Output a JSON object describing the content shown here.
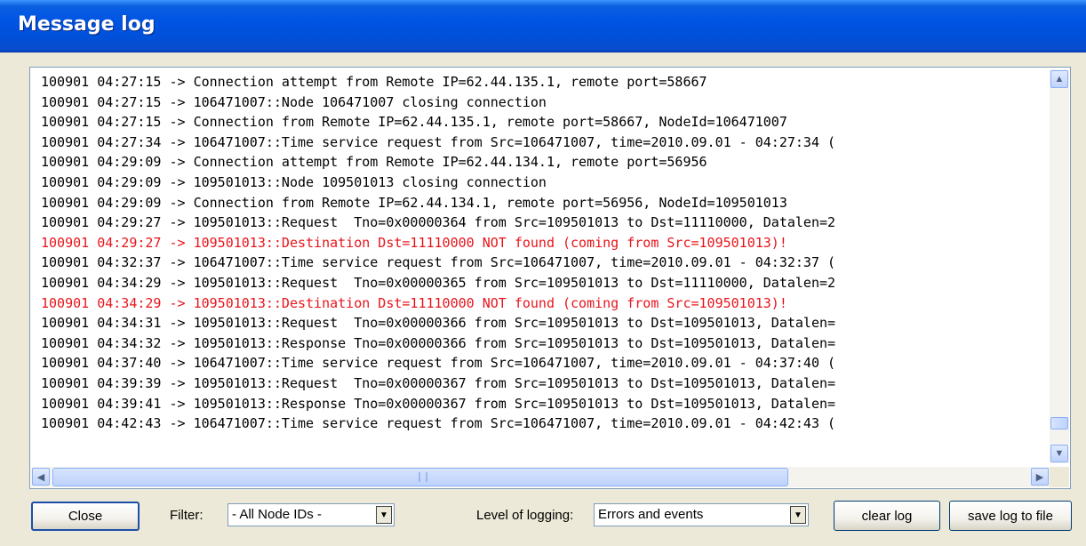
{
  "window": {
    "title": "Message log"
  },
  "log": {
    "lines": [
      {
        "text": "100901 04:27:15 -> Connection attempt from Remote IP=62.44.135.1, remote port=58667",
        "level": "info"
      },
      {
        "text": "100901 04:27:15 -> 106471007::Node 106471007 closing connection",
        "level": "info"
      },
      {
        "text": "100901 04:27:15 -> Connection from Remote IP=62.44.135.1, remote port=58667, NodeId=106471007",
        "level": "info"
      },
      {
        "text": "100901 04:27:34 -> 106471007::Time service request from Src=106471007, time=2010.09.01 - 04:27:34 (",
        "level": "info"
      },
      {
        "text": "100901 04:29:09 -> Connection attempt from Remote IP=62.44.134.1, remote port=56956",
        "level": "info"
      },
      {
        "text": "100901 04:29:09 -> 109501013::Node 109501013 closing connection",
        "level": "info"
      },
      {
        "text": "100901 04:29:09 -> Connection from Remote IP=62.44.134.1, remote port=56956, NodeId=109501013",
        "level": "info"
      },
      {
        "text": "100901 04:29:27 -> 109501013::Request  Tno=0x00000364 from Src=109501013 to Dst=11110000, Datalen=2",
        "level": "info"
      },
      {
        "text": "100901 04:29:27 -> 109501013::Destination Dst=11110000 NOT found (coming from Src=109501013)!",
        "level": "error"
      },
      {
        "text": "100901 04:32:37 -> 106471007::Time service request from Src=106471007, time=2010.09.01 - 04:32:37 (",
        "level": "info"
      },
      {
        "text": "100901 04:34:29 -> 109501013::Request  Tno=0x00000365 from Src=109501013 to Dst=11110000, Datalen=2",
        "level": "info"
      },
      {
        "text": "100901 04:34:29 -> 109501013::Destination Dst=11110000 NOT found (coming from Src=109501013)!",
        "level": "error"
      },
      {
        "text": "100901 04:34:31 -> 109501013::Request  Tno=0x00000366 from Src=109501013 to Dst=109501013, Datalen=",
        "level": "info"
      },
      {
        "text": "100901 04:34:32 -> 109501013::Response Tno=0x00000366 from Src=109501013 to Dst=109501013, Datalen=",
        "level": "info"
      },
      {
        "text": "100901 04:37:40 -> 106471007::Time service request from Src=106471007, time=2010.09.01 - 04:37:40 (",
        "level": "info"
      },
      {
        "text": "100901 04:39:39 -> 109501013::Request  Tno=0x00000367 from Src=109501013 to Dst=109501013, Datalen=",
        "level": "info"
      },
      {
        "text": "100901 04:39:41 -> 109501013::Response Tno=0x00000367 from Src=109501013 to Dst=109501013, Datalen=",
        "level": "info"
      },
      {
        "text": "100901 04:42:43 -> 106471007::Time service request from Src=106471007, time=2010.09.01 - 04:42:43 (",
        "level": "info"
      }
    ],
    "error_color": "#E8141B",
    "text_color": "#000000"
  },
  "scrollbars": {
    "up_icon": "chevron-up-icon",
    "down_icon": "chevron-down-icon",
    "left_icon": "chevron-left-icon",
    "right_icon": "chevron-right-icon"
  },
  "toolbar": {
    "close_label": "Close",
    "filter_label": "Filter:",
    "filter_value": "- All Node IDs -",
    "level_label": "Level of logging:",
    "level_value": "Errors and events",
    "clear_label": "clear log",
    "save_label": "save log to file"
  },
  "colors": {
    "titlebar": "#0054E3",
    "dialog_bg": "#ECE9D8",
    "accent_scroll": "#C1D3FB"
  }
}
